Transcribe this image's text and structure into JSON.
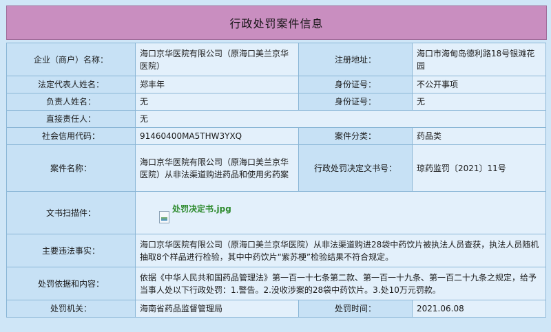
{
  "title": "行政处罚案件信息",
  "rows": {
    "company": {
      "label": "企业（商户）名称：",
      "value": "海口京华医院有限公司（原海口美兰京华医院）",
      "label2": "注册地址：",
      "value2": "海口市海甸岛德利路18号银滩花园"
    },
    "legal_rep": {
      "label": "法定代表人姓名：",
      "value": "郑丰年",
      "label2": "身份证号：",
      "value2": "不公开事项"
    },
    "person_in_charge": {
      "label": "负责人姓名：",
      "value": "无",
      "label2": "身份证号：",
      "value2": "无"
    },
    "direct_responsible": {
      "label": "直接责任人：",
      "value": "无"
    },
    "credit_code": {
      "label": "社会信用代码：",
      "value": "91460400MA5THW3YXQ",
      "label2": "案件分类：",
      "value2": "药品类"
    },
    "case_name": {
      "label": "案件名称：",
      "value": "海口京华医院有限公司（原海口美兰京华医院）从非法渠道购进药品和使用劣药案",
      "label2": "行政处罚决定文书号：",
      "value2": "琼药监罚〔2021〕11号"
    },
    "scan": {
      "label": "文书扫描件：",
      "file_name": "处罚决定书.jpg"
    },
    "violations": {
      "label": "主要违法事实：",
      "value": "海口京华医院有限公司（原海口美兰京华医院）从非法渠道购进28袋中药饮片被执法人员查获，执法人员随机抽取8个样品进行检验，其中中药饮片“紫苏梗”检验结果不符合规定。"
    },
    "basis": {
      "label": "处罚依据和内容：",
      "value": "依据《中华人民共和国药品管理法》第一百一十七条第二款、第一百一十九条、第一百二十九条之规定，给予当事人处以下行政处罚：1.警告。2.没收涉案的28袋中药饮片。3.处10万元罚款。"
    },
    "authority": {
      "label": "处罚机关：",
      "value": "海南省药品监督管理局",
      "label2": "处罚时间：",
      "value2": "2021.06.08"
    }
  }
}
